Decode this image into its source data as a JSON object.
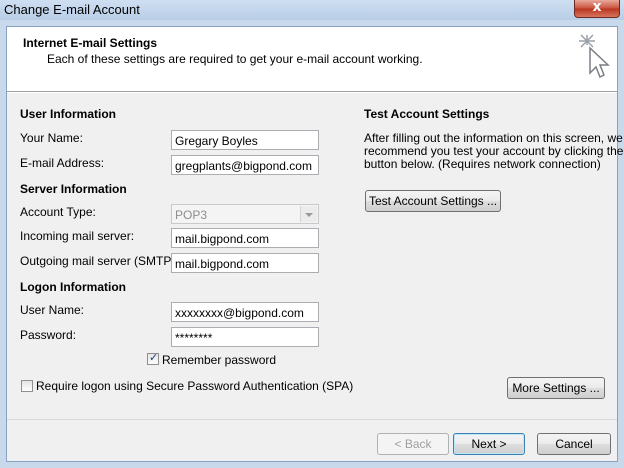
{
  "window": {
    "title": "Change E-mail Account",
    "close_label": "x"
  },
  "header": {
    "title": "Internet E-mail Settings",
    "subtitle": "Each of these settings are required to get your e-mail account working."
  },
  "user_info": {
    "heading": "User Information",
    "name_label": "Your Name:",
    "name_value": "Gregary Boyles",
    "email_label": "E-mail Address:",
    "email_value": "gregplants@bigpond.com"
  },
  "server_info": {
    "heading": "Server Information",
    "account_type_label": "Account Type:",
    "account_type_value": "POP3",
    "incoming_label": "Incoming mail server:",
    "incoming_value": "mail.bigpond.com",
    "outgoing_label": "Outgoing mail server (SMTP):",
    "outgoing_value": "mail.bigpond.com"
  },
  "logon_info": {
    "heading": "Logon Information",
    "username_label": "User Name:",
    "username_value": "xxxxxxxx@bigpond.com",
    "password_label": "Password:",
    "password_value": "********",
    "remember_label": "Remember password",
    "remember_checked": true,
    "spa_label": "Require logon using Secure Password Authentication (SPA)",
    "spa_checked": false
  },
  "test_settings": {
    "heading": "Test Account Settings",
    "description_1": "After filling out the information on this screen, we",
    "description_2": "recommend you test your account by clicking the",
    "description_3": "button below. (Requires network connection)",
    "button_label": "Test Account Settings ..."
  },
  "buttons": {
    "more_settings": "More Settings ...",
    "back": "< Back",
    "next": "Next >",
    "cancel": "Cancel"
  }
}
